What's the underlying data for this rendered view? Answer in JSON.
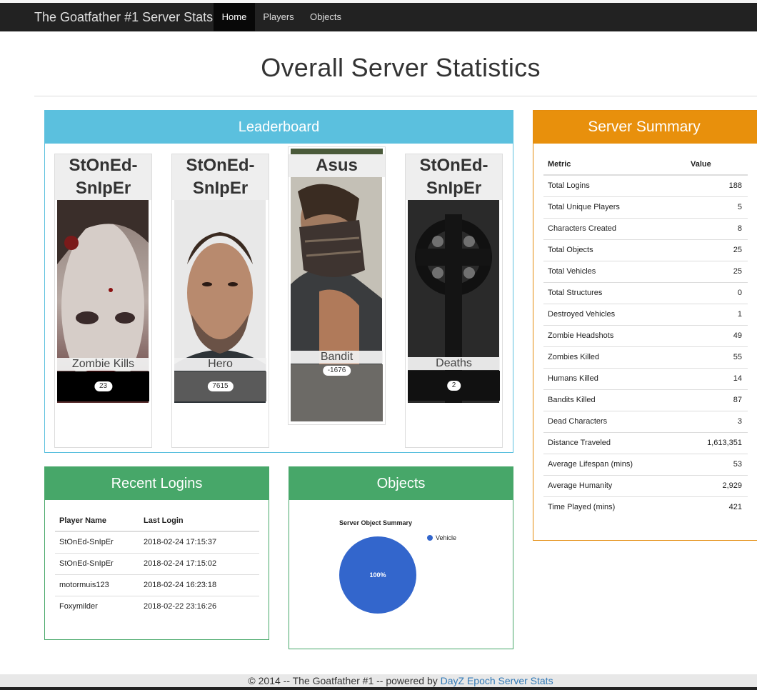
{
  "nav": {
    "brand": "The Goatfather #1 Server Stats",
    "links": [
      "Home",
      "Players",
      "Objects"
    ]
  },
  "title": "Overall Server Statistics",
  "leaderboard": {
    "heading": "Leaderboard",
    "cards": [
      {
        "name": "StOnEd-SnIpEr",
        "label": "Zombie Kills",
        "value": "23"
      },
      {
        "name": "StOnEd-SnIpEr",
        "label": "Hero",
        "value": "7615"
      },
      {
        "name": "Asus",
        "label": "Bandit",
        "value": "-1676"
      },
      {
        "name": "StOnEd-SnIpEr",
        "label": "Deaths",
        "value": "2"
      }
    ]
  },
  "recent_logins": {
    "heading": "Recent Logins",
    "columns": [
      "Player Name",
      "Last Login"
    ],
    "rows": [
      [
        "StOnEd-SnIpEr",
        "2018-02-24 17:15:37"
      ],
      [
        "StOnEd-SnIpEr",
        "2018-02-24 17:15:02"
      ],
      [
        "motormuis123",
        "2018-02-24 16:23:18"
      ],
      [
        "Foxymilder",
        "2018-02-22 23:16:26"
      ]
    ]
  },
  "objects": {
    "heading": "Objects",
    "chart_title": "Server Object Summary",
    "slice_label": "100%",
    "legend": "Vehicle",
    "color": "#3366cc"
  },
  "chart_data": {
    "type": "pie",
    "title": "Server Object Summary",
    "categories": [
      "Vehicle"
    ],
    "values": [
      100
    ],
    "legend": "top-right"
  },
  "summary": {
    "heading": "Server Summary",
    "columns": [
      "Metric",
      "Value"
    ],
    "rows": [
      [
        "Total Logins",
        "188"
      ],
      [
        "Total Unique Players",
        "5"
      ],
      [
        "Characters Created",
        "8"
      ],
      [
        "Total Objects",
        "25"
      ],
      [
        "Total Vehicles",
        "25"
      ],
      [
        "Total Structures",
        "0"
      ],
      [
        "Destroyed Vehicles",
        "1"
      ],
      [
        "Zombie Headshots",
        "49"
      ],
      [
        "Zombies Killed",
        "55"
      ],
      [
        "Humans Killed",
        "14"
      ],
      [
        "Bandits Killed",
        "87"
      ],
      [
        "Dead Characters",
        "3"
      ],
      [
        "Distance Traveled",
        "1,613,351"
      ],
      [
        "Average Lifespan (mins)",
        "53"
      ],
      [
        "Average Humanity",
        "2,929"
      ],
      [
        "Time Played (mins)",
        "421"
      ]
    ]
  },
  "footer": {
    "text": "© 2014 -- The Goatfather #1 -- powered by ",
    "link": "DayZ Epoch Server Stats"
  },
  "colors": {
    "navbar": "#222222",
    "info": "#5bc0de",
    "success": "#47a769",
    "warning": "#e8900c",
    "link": "#337ab7"
  }
}
